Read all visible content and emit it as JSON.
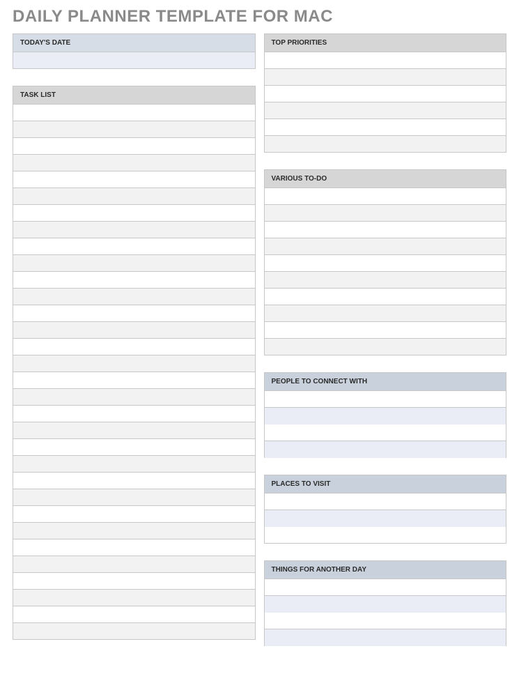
{
  "title": "DAILY PLANNER TEMPLATE FOR MAC",
  "colors": {
    "header_lightblue": "#d6dde6",
    "header_gray": "#d6d6d6",
    "header_steel": "#c8d1dc",
    "row_gray": "#f2f2f2",
    "row_blue": "#eaedf5"
  },
  "left": {
    "todays_date": {
      "label": "TODAY'S DATE",
      "rows": 1,
      "alt": "blue"
    },
    "task_list": {
      "label": "TASK LIST",
      "rows": 32,
      "alt": "gray"
    }
  },
  "right": {
    "top_priorities": {
      "label": "TOP PRIORITIES",
      "rows": 6,
      "alt": "gray"
    },
    "various_todo": {
      "label": "VARIOUS TO-DO",
      "rows": 10,
      "alt": "gray"
    },
    "people_connect": {
      "label": "PEOPLE TO CONNECT WITH",
      "rows": 4,
      "alt": "blue"
    },
    "places_visit": {
      "label": "PLACES TO VISIT",
      "rows": 3,
      "alt": "blue"
    },
    "things_another_day": {
      "label": "THINGS FOR ANOTHER DAY",
      "rows": 4,
      "alt": "blue"
    }
  }
}
